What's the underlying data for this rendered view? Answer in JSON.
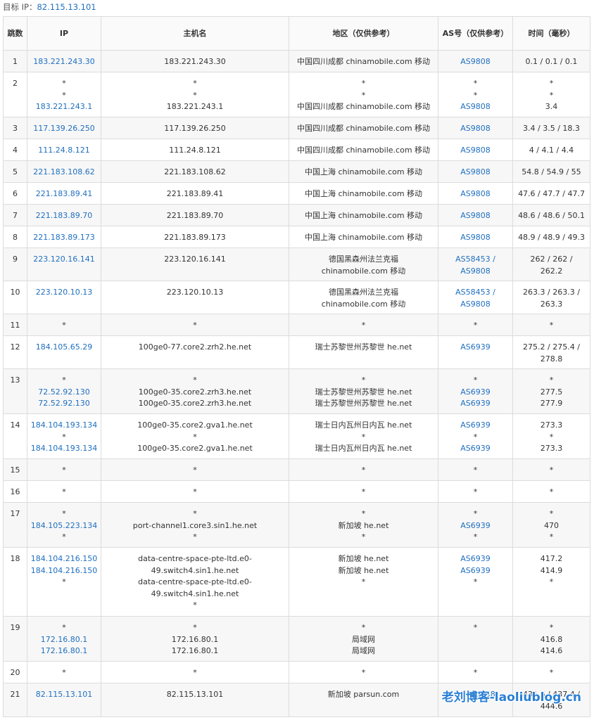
{
  "target": {
    "label": "目标 IP：",
    "ip": "82.115.13.101"
  },
  "headers": [
    "跳数",
    "IP",
    "主机名",
    "地区（仅供参考）",
    "AS号（仅供参考）",
    "时间（毫秒）"
  ],
  "rows": [
    {
      "hop": "1",
      "ip": [
        "183.221.243.30"
      ],
      "host": [
        "183.221.243.30"
      ],
      "region": [
        "中国四川成都 chinamobile.com 移动"
      ],
      "asn": [
        "AS9808"
      ],
      "time": [
        "0.1 / 0.1 / 0.1"
      ]
    },
    {
      "hop": "2",
      "ip": [
        "*",
        "*",
        "183.221.243.1"
      ],
      "host": [
        "*",
        "*",
        "183.221.243.1"
      ],
      "region": [
        "*",
        "*",
        "中国四川成都 chinamobile.com 移动"
      ],
      "asn": [
        "*",
        "*",
        "AS9808"
      ],
      "time": [
        "*",
        "*",
        "3.4"
      ]
    },
    {
      "hop": "3",
      "ip": [
        "117.139.26.250"
      ],
      "host": [
        "117.139.26.250"
      ],
      "region": [
        "中国四川成都 chinamobile.com 移动"
      ],
      "asn": [
        "AS9808"
      ],
      "time": [
        "3.4 / 3.5 / 18.3"
      ]
    },
    {
      "hop": "4",
      "ip": [
        "111.24.8.121"
      ],
      "host": [
        "111.24.8.121"
      ],
      "region": [
        "中国四川成都 chinamobile.com 移动"
      ],
      "asn": [
        "AS9808"
      ],
      "time": [
        "4 / 4.1 / 4.4"
      ]
    },
    {
      "hop": "5",
      "ip": [
        "221.183.108.62"
      ],
      "host": [
        "221.183.108.62"
      ],
      "region": [
        "中国上海 chinamobile.com 移动"
      ],
      "asn": [
        "AS9808"
      ],
      "time": [
        "54.8 / 54.9 / 55"
      ]
    },
    {
      "hop": "6",
      "ip": [
        "221.183.89.41"
      ],
      "host": [
        "221.183.89.41"
      ],
      "region": [
        "中国上海 chinamobile.com 移动"
      ],
      "asn": [
        "AS9808"
      ],
      "time": [
        "47.6 / 47.7 / 47.7"
      ]
    },
    {
      "hop": "7",
      "ip": [
        "221.183.89.70"
      ],
      "host": [
        "221.183.89.70"
      ],
      "region": [
        "中国上海 chinamobile.com 移动"
      ],
      "asn": [
        "AS9808"
      ],
      "time": [
        "48.6 / 48.6 / 50.1"
      ]
    },
    {
      "hop": "8",
      "ip": [
        "221.183.89.173"
      ],
      "host": [
        "221.183.89.173"
      ],
      "region": [
        "中国上海 chinamobile.com 移动"
      ],
      "asn": [
        "AS9808"
      ],
      "time": [
        "48.9 / 48.9 / 49.3"
      ]
    },
    {
      "hop": "9",
      "ip": [
        "223.120.16.141"
      ],
      "host": [
        "223.120.16.141"
      ],
      "region": [
        "德国黑森州法兰克福",
        "chinamobile.com 移动"
      ],
      "asn": [
        "AS58453 /",
        "AS9808"
      ],
      "time": [
        "262 / 262 /",
        "262.2"
      ]
    },
    {
      "hop": "10",
      "ip": [
        "223.120.10.13"
      ],
      "host": [
        "223.120.10.13"
      ],
      "region": [
        "德国黑森州法兰克福",
        "chinamobile.com 移动"
      ],
      "asn": [
        "AS58453 /",
        "AS9808"
      ],
      "time": [
        "263.3 / 263.3 /",
        "263.3"
      ]
    },
    {
      "hop": "11",
      "ip": [
        "*"
      ],
      "host": [
        "*"
      ],
      "region": [
        "*"
      ],
      "asn": [
        "*"
      ],
      "time": [
        "*"
      ]
    },
    {
      "hop": "12",
      "ip": [
        "184.105.65.29"
      ],
      "host": [
        "100ge0-77.core2.zrh2.he.net"
      ],
      "region": [
        "瑞士苏黎世州苏黎世 he.net"
      ],
      "asn": [
        "AS6939"
      ],
      "time": [
        "275.2 / 275.4 /",
        "278.8"
      ]
    },
    {
      "hop": "13",
      "ip": [
        "*",
        "72.52.92.130",
        "72.52.92.130"
      ],
      "host": [
        "*",
        "100ge0-35.core2.zrh3.he.net",
        "100ge0-35.core2.zrh3.he.net"
      ],
      "region": [
        "*",
        "瑞士苏黎世州苏黎世 he.net",
        "瑞士苏黎世州苏黎世 he.net"
      ],
      "asn": [
        "*",
        "AS6939",
        "AS6939"
      ],
      "time": [
        "*",
        "277.5",
        "277.9"
      ]
    },
    {
      "hop": "14",
      "ip": [
        "184.104.193.134",
        "*",
        "184.104.193.134"
      ],
      "host": [
        "100ge0-35.core2.gva1.he.net",
        "*",
        "100ge0-35.core2.gva1.he.net"
      ],
      "region": [
        "瑞士日内瓦州日内瓦 he.net",
        "*",
        "瑞士日内瓦州日内瓦 he.net"
      ],
      "asn": [
        "AS6939",
        "*",
        "AS6939"
      ],
      "time": [
        "273.3",
        "*",
        "273.3"
      ]
    },
    {
      "hop": "15",
      "ip": [
        "*"
      ],
      "host": [
        "*"
      ],
      "region": [
        "*"
      ],
      "asn": [
        "*"
      ],
      "time": [
        "*"
      ]
    },
    {
      "hop": "16",
      "ip": [
        "*"
      ],
      "host": [
        "*"
      ],
      "region": [
        "*"
      ],
      "asn": [
        "*"
      ],
      "time": [
        "*"
      ]
    },
    {
      "hop": "17",
      "ip": [
        "*",
        "184.105.223.134",
        "*"
      ],
      "host": [
        "*",
        "port-channel1.core3.sin1.he.net",
        "*"
      ],
      "region": [
        "*",
        "新加坡 he.net",
        "*"
      ],
      "asn": [
        "*",
        "AS6939",
        "*"
      ],
      "time": [
        "*",
        "470",
        "*"
      ]
    },
    {
      "hop": "18",
      "ip": [
        "184.104.216.150",
        "184.104.216.150",
        "*"
      ],
      "host": [
        "data-centre-space-pte-ltd.e0-",
        "49.switch4.sin1.he.net",
        "data-centre-space-pte-ltd.e0-",
        "49.switch4.sin1.he.net",
        "*"
      ],
      "region": [
        "新加坡 he.net",
        "新加坡 he.net",
        "*"
      ],
      "asn": [
        "AS6939",
        "AS6939",
        "*"
      ],
      "time": [
        "417.2",
        "414.9",
        "*"
      ]
    },
    {
      "hop": "19",
      "ip": [
        "*",
        "172.16.80.1",
        "172.16.80.1"
      ],
      "host": [
        "*",
        "172.16.80.1",
        "172.16.80.1"
      ],
      "region": [
        "*",
        "局域网",
        "局域网"
      ],
      "asn": [
        "*"
      ],
      "time": [
        "*",
        "416.8",
        "414.6"
      ]
    },
    {
      "hop": "20",
      "ip": [
        "*"
      ],
      "host": [
        "*"
      ],
      "region": [
        "*"
      ],
      "asn": [
        "*"
      ],
      "time": [
        "*"
      ]
    },
    {
      "hop": "21",
      "ip": [
        "82.115.13.101"
      ],
      "host": [
        "82.115.13.101"
      ],
      "region": [
        "新加坡 parsun.com"
      ],
      "asn": [
        "AS136258"
      ],
      "time": [
        "431.6 / 437.4 /",
        "444.6"
      ]
    }
  ],
  "watermark": "老刘博客-laoliublog.cn",
  "colors": {
    "link": "#1f6fbf",
    "border": "#dcdcdc",
    "stripe": "#f7f7f7"
  }
}
